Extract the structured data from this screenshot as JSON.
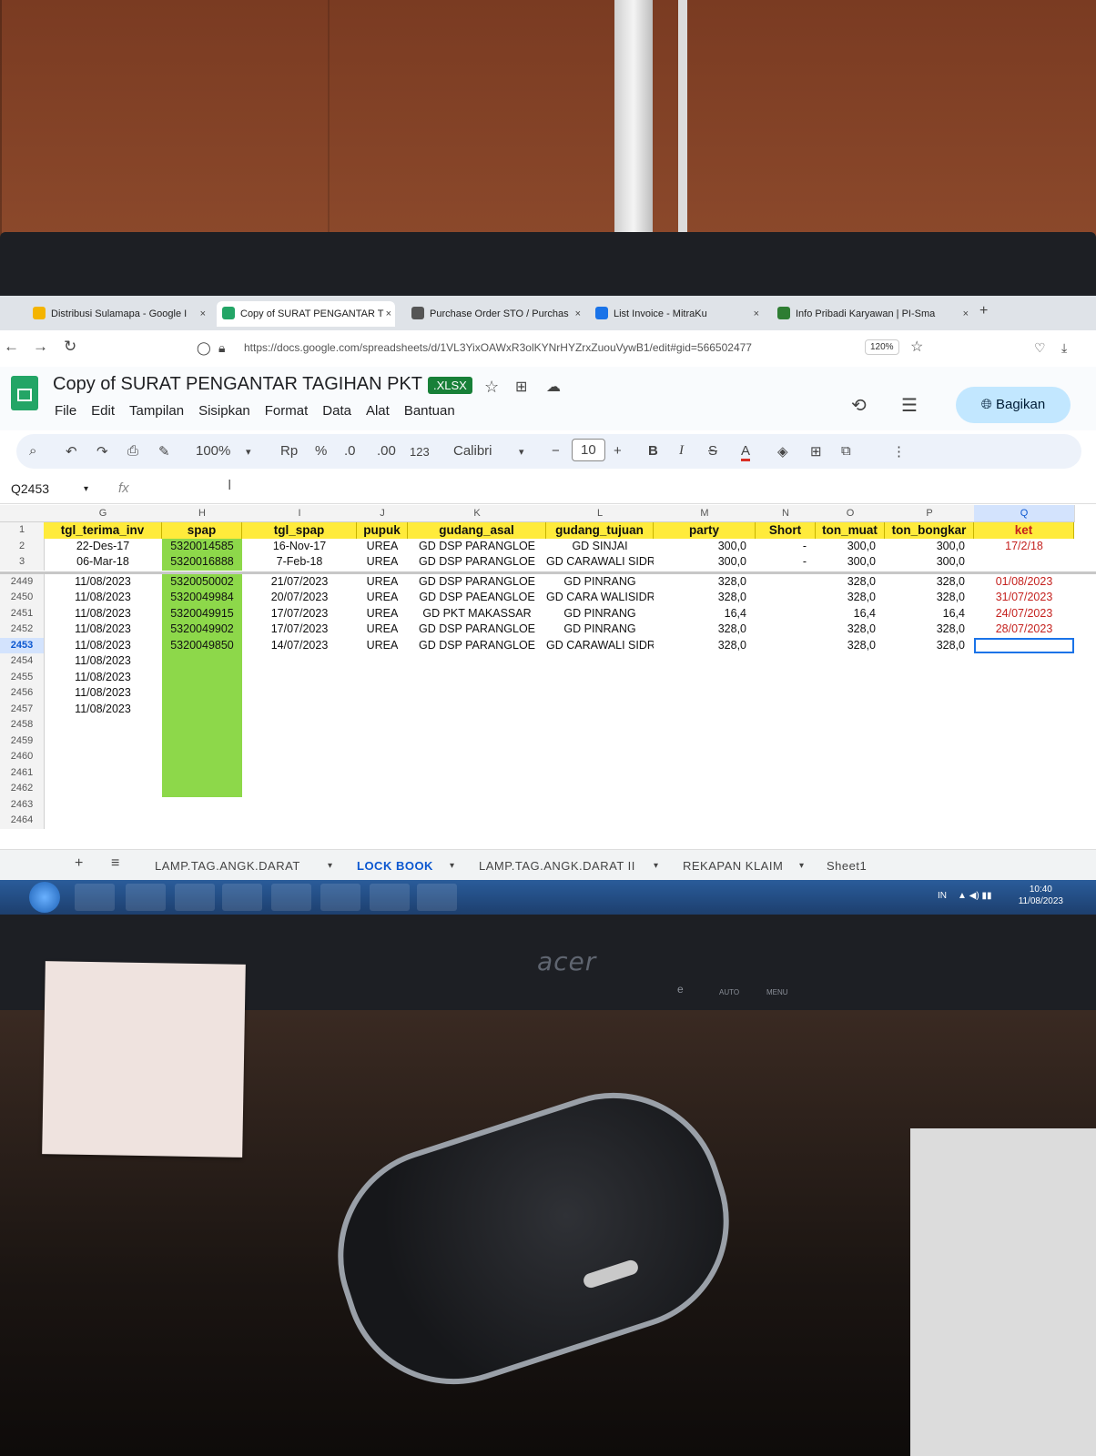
{
  "browser": {
    "tabs": [
      {
        "label": "Distribusi Sulamapa - Google I",
        "icon": "drive-icon",
        "active": false
      },
      {
        "label": "Copy of SURAT PENGANTAR T",
        "icon": "sheets-icon",
        "active": true
      },
      {
        "label": "Purchase Order STO / Purchas",
        "icon": "globe-icon",
        "active": false
      },
      {
        "label": "List Invoice - MitraKu",
        "icon": "mitraku-icon",
        "active": false
      },
      {
        "label": "Info Pribadi Karyawan | PI-Sma",
        "icon": "network-icon",
        "active": false
      }
    ],
    "url": "https://docs.google.com/spreadsheets/d/1VL3YixOAWxR3olKYNrHYZrxZuouVywB1/edit#gid=566502477",
    "zoom": "120%"
  },
  "doc": {
    "title": "Copy of SURAT PENGANTAR TAGIHAN PKT",
    "badge": ".XLSX",
    "menu": [
      "File",
      "Edit",
      "Tampilan",
      "Sisipkan",
      "Format",
      "Data",
      "Alat",
      "Bantuan"
    ],
    "share_label": "Bagikan"
  },
  "toolbar": {
    "zoom": "100%",
    "currency": "Rp",
    "percent": "%",
    "dec_less": ".0",
    "dec_more": ".00",
    "number_format": "123",
    "font": "Calibri",
    "font_size": "10",
    "bold": "B",
    "italic": "I",
    "text_color": "A"
  },
  "formula_bar": {
    "cell_ref": "Q2453",
    "fx": "fx"
  },
  "columns": [
    "G",
    "H",
    "I",
    "J",
    "K",
    "L",
    "M",
    "N",
    "O",
    "P",
    "Q"
  ],
  "header_row": {
    "row_num": "1",
    "cells": [
      "tgl_terima_inv",
      "spap",
      "tgl_spap",
      "pupuk",
      "gudang_asal",
      "gudang_tujuan",
      "party",
      "Short",
      "ton_muat",
      "ton_bongkar",
      "ket"
    ]
  },
  "rows": [
    {
      "num": "2",
      "cells": [
        "22-Des-17",
        "5320014585",
        "16-Nov-17",
        "UREA",
        "GD DSP PARANGLOE",
        "GD SINJAI",
        "300,0",
        "-",
        "300,0",
        "300,0",
        "17/2/18"
      ]
    },
    {
      "num": "3",
      "cells": [
        "06-Mar-18",
        "5320016888",
        "7-Feb-18",
        "UREA",
        "GD DSP PARANGLOE",
        "GD CARAWALI SIDRAP",
        "300,0",
        "-",
        "300,0",
        "300,0",
        ""
      ]
    },
    {
      "num": "2449",
      "cells": [
        "11/08/2023",
        "5320050002",
        "21/07/2023",
        "UREA",
        "GD DSP PARANGLOE",
        "GD PINRANG",
        "328,0",
        "",
        "328,0",
        "328,0",
        "01/08/2023"
      ]
    },
    {
      "num": "2450",
      "cells": [
        "11/08/2023",
        "5320049984",
        "20/07/2023",
        "UREA",
        "GD DSP PAEANGLOE",
        "GD CARA WALISIDRAP",
        "328,0",
        "",
        "328,0",
        "328,0",
        "31/07/2023"
      ]
    },
    {
      "num": "2451",
      "cells": [
        "11/08/2023",
        "5320049915",
        "17/07/2023",
        "UREA",
        "GD PKT MAKASSAR",
        "GD PINRANG",
        "16,4",
        "",
        "16,4",
        "16,4",
        "24/07/2023"
      ]
    },
    {
      "num": "2452",
      "cells": [
        "11/08/2023",
        "5320049902",
        "17/07/2023",
        "UREA",
        "GD DSP PARANGLOE",
        "GD PINRANG",
        "328,0",
        "",
        "328,0",
        "328,0",
        "28/07/2023"
      ]
    },
    {
      "num": "2453",
      "cells": [
        "11/08/2023",
        "5320049850",
        "14/07/2023",
        "UREA",
        "GD DSP PARANGLOE",
        "GD CARAWALI SIDRAP",
        "328,0",
        "",
        "328,0",
        "328,0",
        ""
      ]
    },
    {
      "num": "2454",
      "cells": [
        "11/08/2023",
        "",
        "",
        "",
        "",
        "",
        "",
        "",
        "",
        "",
        ""
      ]
    },
    {
      "num": "2455",
      "cells": [
        "11/08/2023",
        "",
        "",
        "",
        "",
        "",
        "",
        "",
        "",
        "",
        ""
      ]
    },
    {
      "num": "2456",
      "cells": [
        "11/08/2023",
        "",
        "",
        "",
        "",
        "",
        "",
        "",
        "",
        "",
        ""
      ]
    },
    {
      "num": "2457",
      "cells": [
        "11/08/2023",
        "",
        "",
        "",
        "",
        "",
        "",
        "",
        "",
        "",
        ""
      ]
    },
    {
      "num": "2458",
      "cells": [
        "",
        "",
        "",
        "",
        "",
        "",
        "",
        "",
        "",
        "",
        ""
      ]
    },
    {
      "num": "2459",
      "cells": [
        "",
        "",
        "",
        "",
        "",
        "",
        "",
        "",
        "",
        "",
        ""
      ]
    },
    {
      "num": "2460",
      "cells": [
        "",
        "",
        "",
        "",
        "",
        "",
        "",
        "",
        "",
        "",
        ""
      ]
    },
    {
      "num": "2461",
      "cells": [
        "",
        "",
        "",
        "",
        "",
        "",
        "",
        "",
        "",
        "",
        ""
      ]
    },
    {
      "num": "2462",
      "cells": [
        "",
        "",
        "",
        "",
        "",
        "",
        "",
        "",
        "",
        "",
        ""
      ]
    },
    {
      "num": "2463",
      "cells": [
        "",
        "",
        "",
        "",
        "",
        "",
        "",
        "",
        "",
        "",
        ""
      ]
    },
    {
      "num": "2464",
      "cells": [
        "",
        "",
        "",
        "",
        "",
        "",
        "",
        "",
        "",
        "",
        ""
      ]
    }
  ],
  "sheet_tabs": [
    {
      "label": "LAMP.TAG.ANGK.DARAT",
      "active": false
    },
    {
      "label": "LOCK BOOK",
      "active": true
    },
    {
      "label": "LAMP.TAG.ANGK.DARAT II",
      "active": false
    },
    {
      "label": "REKAPAN KLAIM",
      "active": false
    },
    {
      "label": "Sheet1",
      "active": false
    }
  ],
  "taskbar": {
    "lang": "IN",
    "time": "10:40",
    "date": "11/08/2023"
  },
  "monitor_brand": "acer",
  "monitor_buttons": [
    "e",
    "AUTO",
    "MENU"
  ],
  "colors": {
    "header_fill": "#ffeb3b",
    "spap_fill": "#8dd84a",
    "ket_text": "#c5221f",
    "selection": "#1a73e8",
    "share_bg": "#c2e7ff"
  }
}
